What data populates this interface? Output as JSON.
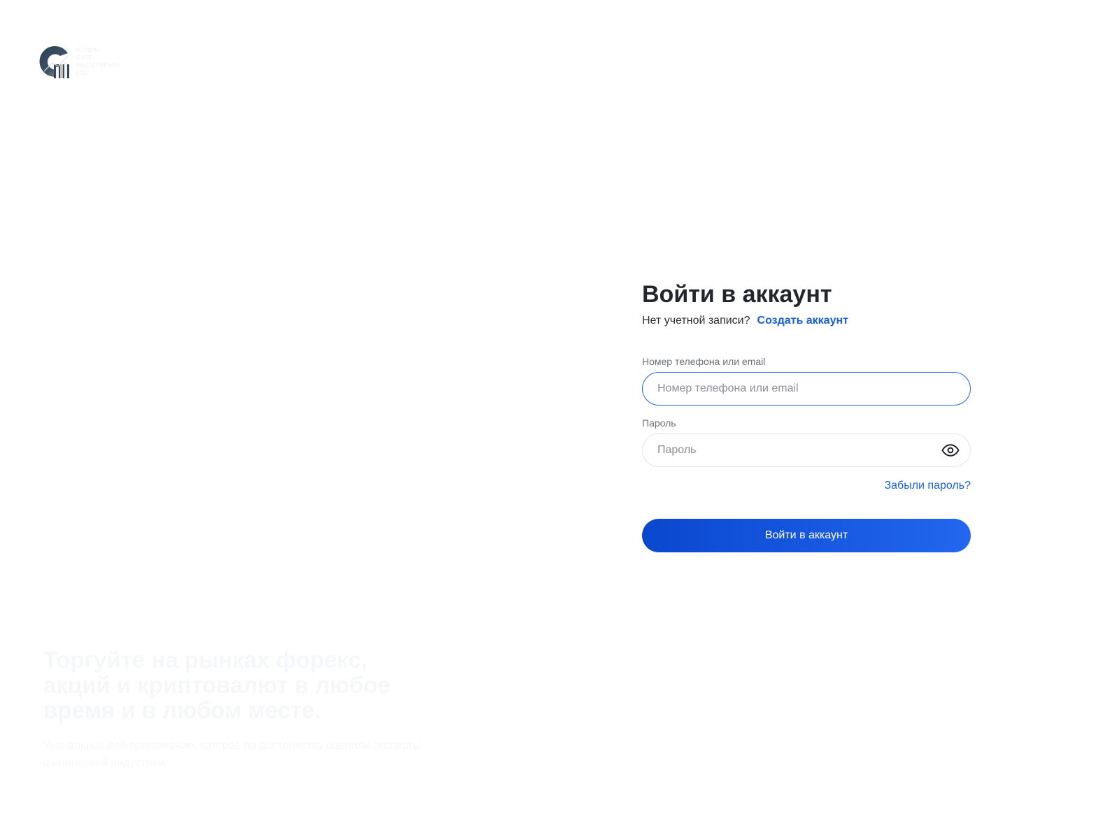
{
  "logo": {
    "icon": "g-chart-logo-icon",
    "tagline_lines": [
      "GLOBAL",
      "GATE",
      "INVESTMENTS",
      "LTD"
    ]
  },
  "promo": {
    "title": "Торгуйте на рынках форекс, акций и криптовалют в любое время и в любом месте.",
    "subtitle": "Уникальное веб-приложение, которое по достоинству оценили эксперты финансовой индустрии"
  },
  "login": {
    "title": "Войти в аккаунт",
    "no_account_text": "Нет учетной записи?",
    "create_account_link": "Создать аккаунт",
    "login_field": {
      "label": "Номер телефона или email",
      "placeholder": "Номер телефона или email",
      "value": ""
    },
    "password_field": {
      "label": "Пароль",
      "placeholder": "Пароль",
      "value": "",
      "toggle_icon": "eye-icon"
    },
    "forgot_password_link": "Забыли пароль?",
    "submit_label": "Войти в аккаунт"
  },
  "colors": {
    "accent": "#1a5fd6",
    "button_gradient_start": "#0a47cf",
    "button_gradient_end": "#2267ee",
    "title_text": "#23262b",
    "focus_border": "#2a63d8"
  }
}
